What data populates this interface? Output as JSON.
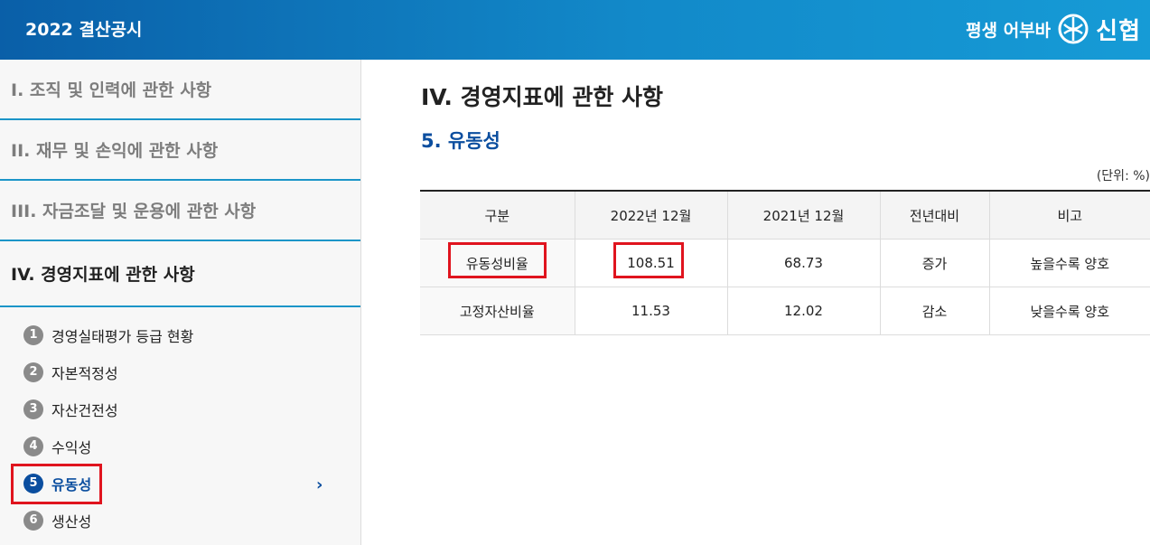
{
  "header": {
    "title": "2022 결산공시",
    "slogan": "평생 어부바",
    "brand_name": "신협",
    "logo_icon": "shinhyup-logo-icon",
    "colors": {
      "header_start": "#0a5fa8",
      "header_end": "#169bd6"
    }
  },
  "sidebar": {
    "sections": [
      {
        "label": "I. 조직 및 인력에 관한 사항"
      },
      {
        "label": "II. 재무 및 손익에 관한 사항"
      },
      {
        "label": "III. 자금조달 및 운용에 관한 사항"
      },
      {
        "label": "IV. 경영지표에 관한 사항"
      }
    ],
    "subitems": [
      {
        "num": "1",
        "label": "경영실태평가 등급 현황"
      },
      {
        "num": "2",
        "label": "자본적정성"
      },
      {
        "num": "3",
        "label": "자산건전성"
      },
      {
        "num": "4",
        "label": "수익성"
      },
      {
        "num": "5",
        "label": "유동성"
      },
      {
        "num": "6",
        "label": "생산성"
      }
    ],
    "active_chevron": "›",
    "colors": {
      "accent": "#0b4e9f",
      "section_border": "#1b95c8",
      "highlight": "#e0141e"
    }
  },
  "main": {
    "title": "IV. 경영지표에 관한 사항",
    "section_title": "5. 유동성",
    "unit": "(단위: %)",
    "table": {
      "headers": [
        "구분",
        "2022년 12월",
        "2021년 12월",
        "전년대비",
        "비고"
      ],
      "rows": [
        [
          "유동성비율",
          "108.51",
          "68.73",
          "증가",
          "높을수록 양호"
        ],
        [
          "고정자산비율",
          "11.53",
          "12.02",
          "감소",
          "낮을수록 양호"
        ]
      ]
    }
  }
}
